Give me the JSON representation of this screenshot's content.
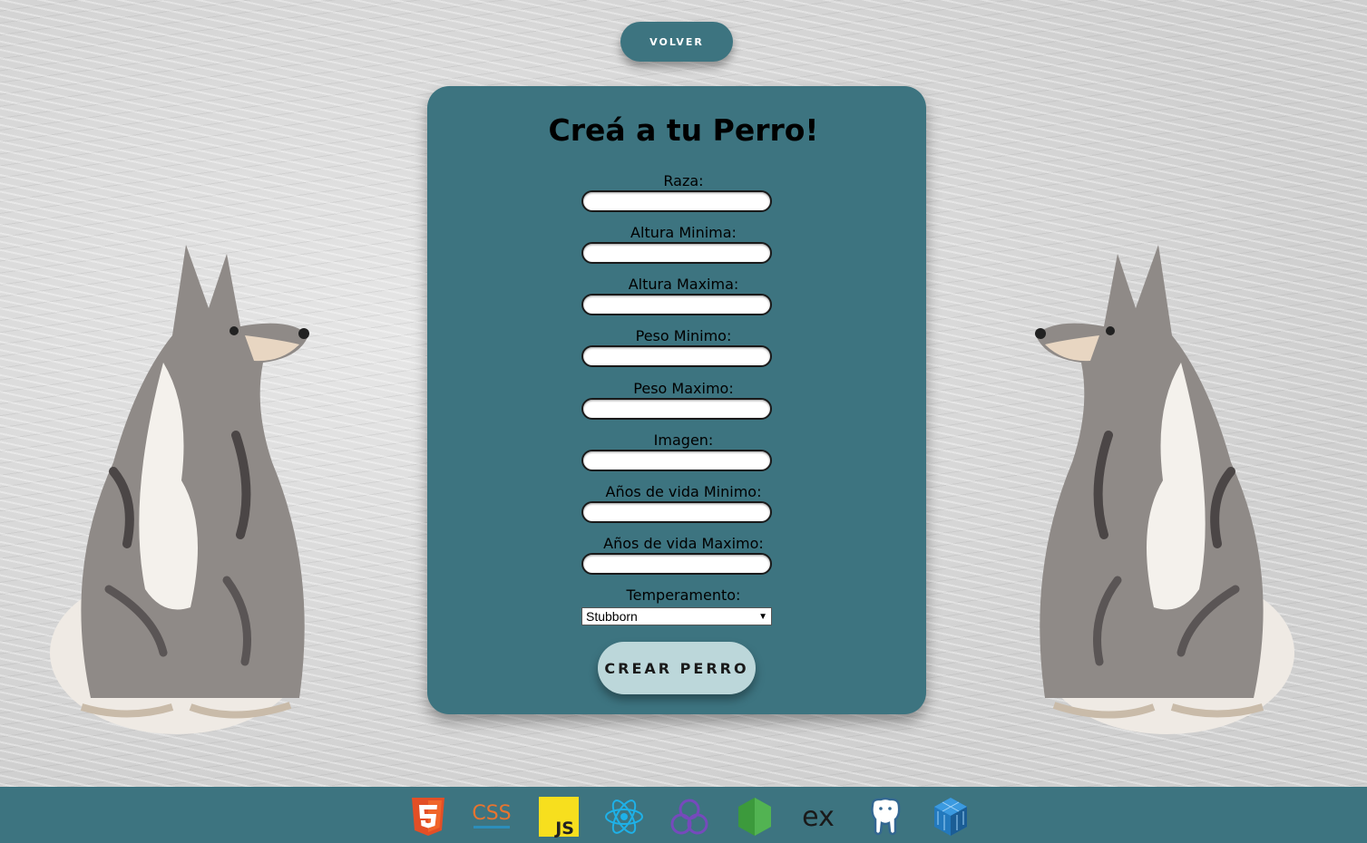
{
  "nav": {
    "back_label": "VOLVER"
  },
  "form": {
    "title": "Creá a tu Perro!",
    "fields": [
      {
        "label": "Raza:",
        "value": ""
      },
      {
        "label": "Altura Minima:",
        "value": ""
      },
      {
        "label": "Altura Maxima:",
        "value": ""
      },
      {
        "label": "Peso Minimo:",
        "value": ""
      },
      {
        "label": "Peso Maximo:",
        "value": ""
      },
      {
        "label": "Imagen:",
        "value": ""
      },
      {
        "label": "Años de vida Minimo:",
        "value": ""
      },
      {
        "label": "Años de vida Maximo:",
        "value": ""
      }
    ],
    "temperament": {
      "label": "Temperamento:",
      "selected": "Stubborn"
    },
    "submit_label": "CREAR PERRO"
  },
  "footer": {
    "tech_icons": [
      "html5-icon",
      "css3-icon",
      "javascript-icon",
      "react-icon",
      "redux-icon",
      "nodejs-icon",
      "express-icon",
      "postgresql-icon",
      "sequelize-icon"
    ]
  },
  "colors": {
    "primary": "#3d7480",
    "button_light": "#bcd7da",
    "background": "#d8d8d8"
  }
}
